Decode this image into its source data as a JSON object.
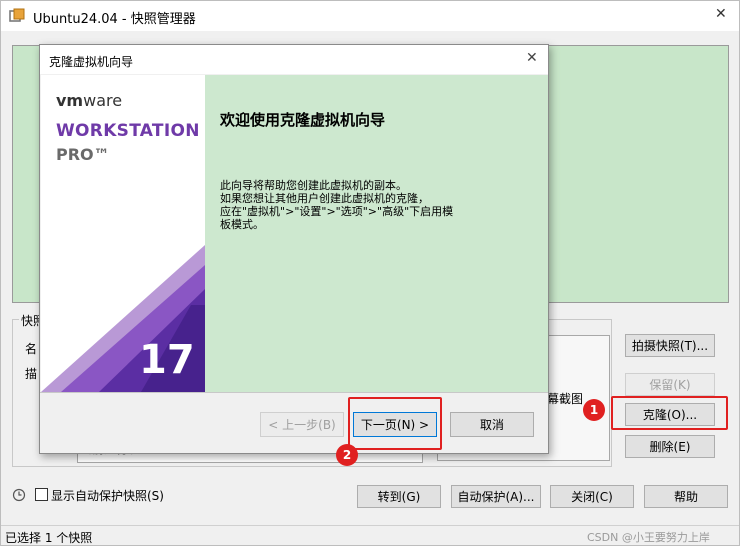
{
  "main_window": {
    "title": "Ubuntu24.04 - 快照管理器",
    "close_glyph": "✕"
  },
  "snapshot_section": {
    "group_label": "快照",
    "name_label_partial": "名",
    "desc_label_partial": "描",
    "screenshot_label_partial": "幕截图",
    "list_value_partial": "当前运行状态"
  },
  "side_buttons": {
    "take_snapshot": "拍摄快照(T)...",
    "keep": "保留(K)",
    "clone": "克隆(O)...",
    "delete": "删除(E)"
  },
  "bottom_bar": {
    "show_autoprotect": "显示自动保护快照(S)",
    "goto": "转到(G)",
    "autoprotect": "自动保护(A)...",
    "close": "关闭(C)",
    "help": "帮助"
  },
  "status_bar": {
    "text": "已选择 1 个快照",
    "watermark": "CSDN @小王要努力上岸"
  },
  "dialog": {
    "title": "克隆虚拟机向导",
    "close_glyph": "✕",
    "brand_vm": "vm",
    "brand_ware": "ware",
    "product_line1": "WORKSTATION",
    "product_line2": "PRO™",
    "version": "17",
    "heading": "欢迎使用克隆虚拟机向导",
    "body_lines": [
      "此向导将帮助您创建此虚拟机的副本。",
      "如果您想让其他用户创建此虚拟机的克隆，",
      "应在\"虚拟机\">\"设置\">\"选项\">\"高级\"下启用模",
      "板模式。"
    ],
    "prev_button": "< 上一步(B)",
    "next_button": "下一页(N) >",
    "cancel_button": "取消"
  },
  "annotations": {
    "badge1": "1",
    "badge2": "2"
  },
  "colors": {
    "preview_green": "#c8e6c9",
    "dialog_green": "#cde8cf",
    "highlight_red": "#e02020",
    "brand_purple": "#6f3aa8"
  }
}
